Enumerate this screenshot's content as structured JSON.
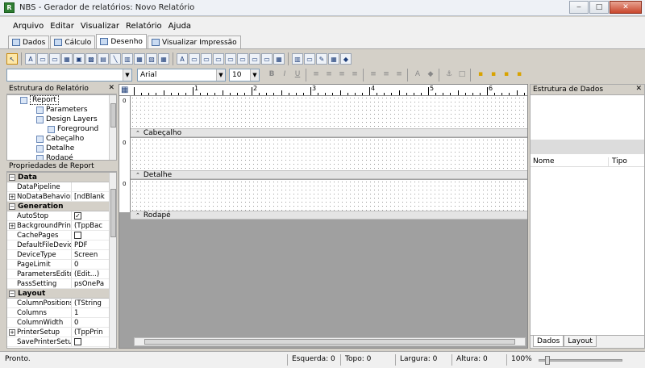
{
  "window": {
    "title": "NBS - Gerador de relatórios: Novo Relatório",
    "app_icon_glyph": "R",
    "minimize_glyph": "‒",
    "maximize_glyph": "□",
    "close_glyph": "✕"
  },
  "menu": [
    "Arquivo",
    "Editar",
    "Visualizar",
    "Relatório",
    "Ajuda"
  ],
  "doc_tabs": [
    "Dados",
    "Cálculo",
    "Desenho",
    "Visualizar Impressão"
  ],
  "active_doc_tab": "Desenho",
  "toolbar1_glyphs": [
    "↖",
    "A",
    "▭",
    "▭",
    "▦",
    "▣",
    "▩",
    "▤",
    "╲",
    "▥",
    "▦",
    "▨",
    "▦",
    "A",
    "▭",
    "▭",
    "▭",
    "▭",
    "▭",
    "▭",
    "▭",
    "▦",
    "▥",
    "▭",
    "✎",
    "▦",
    "◆"
  ],
  "format_bar": {
    "font_name": "Arial",
    "font_size": "10",
    "combo_arrow": "▼",
    "buttons": [
      "B",
      "I",
      "U",
      "≡",
      "≡",
      "≡",
      "≡",
      "≡",
      "≡",
      "≡",
      "A",
      "◆",
      "⚓",
      "□",
      "▪",
      "▪",
      "▪",
      "▪"
    ]
  },
  "report_tree": {
    "title": "Estrutura do Relatório",
    "close_glyph": "✕",
    "items": [
      {
        "label": "Report",
        "selected": true
      },
      {
        "label": "Parameters"
      },
      {
        "label": "Design Layers"
      },
      {
        "label": "Foreground"
      },
      {
        "label": "Cabeçalho"
      },
      {
        "label": "Detalhe"
      },
      {
        "label": "Rodapé"
      }
    ]
  },
  "properties": {
    "title": "Propriedades de Report",
    "expand_glyph": "+",
    "collapse_glyph": "−",
    "check_glyph": "✓",
    "categories": [
      {
        "name": "Data",
        "rows": [
          {
            "name": "DataPipeline",
            "value": ""
          },
          {
            "name": "NoDataBehaviors",
            "value": "[ndBlank",
            "expandable": true
          }
        ]
      },
      {
        "name": "Generation",
        "rows": [
          {
            "name": "AutoStop",
            "check": true
          },
          {
            "name": "BackgroundPrintSe",
            "value": "(TppBac",
            "expandable": true
          },
          {
            "name": "CachePages",
            "check": false
          },
          {
            "name": "DefaultFileDeviceT",
            "value": "PDF"
          },
          {
            "name": "DeviceType",
            "value": "Screen"
          },
          {
            "name": "PageLimit",
            "value": "0"
          },
          {
            "name": "ParametersEditor",
            "value": "(Edit...)"
          },
          {
            "name": "PassSetting",
            "value": "psOnePa"
          }
        ]
      },
      {
        "name": "Layout",
        "rows": [
          {
            "name": "ColumnPositions",
            "value": "(TString"
          },
          {
            "name": "Columns",
            "value": "1"
          },
          {
            "name": "ColumnWidth",
            "value": "0"
          },
          {
            "name": "PrinterSetup",
            "value": "(TppPrin",
            "expandable": true
          },
          {
            "name": "SavePrinterSetup",
            "check": false
          }
        ]
      }
    ]
  },
  "designer": {
    "ruler_numbers": [
      "1",
      "2",
      "3",
      "4",
      "5",
      "6"
    ],
    "vruler_numbers": [
      "0",
      "0",
      "0"
    ],
    "band_caret": "⌃",
    "corner_glyph": "▦",
    "bands": [
      "Cabeçalho",
      "Detalhe",
      "Rodapé"
    ]
  },
  "data_structure": {
    "title": "Estrutura de Dados",
    "close_glyph": "✕",
    "columns": [
      "Nome",
      "Tipo"
    ],
    "tabs": [
      "Dados",
      "Layout"
    ],
    "active_tab": "Dados"
  },
  "status": {
    "state": "Pronto.",
    "left": "Esquerda: 0",
    "top": "Topo: 0",
    "width": "Largura: 0",
    "height": "Altura: 0",
    "zoom": "100%"
  }
}
